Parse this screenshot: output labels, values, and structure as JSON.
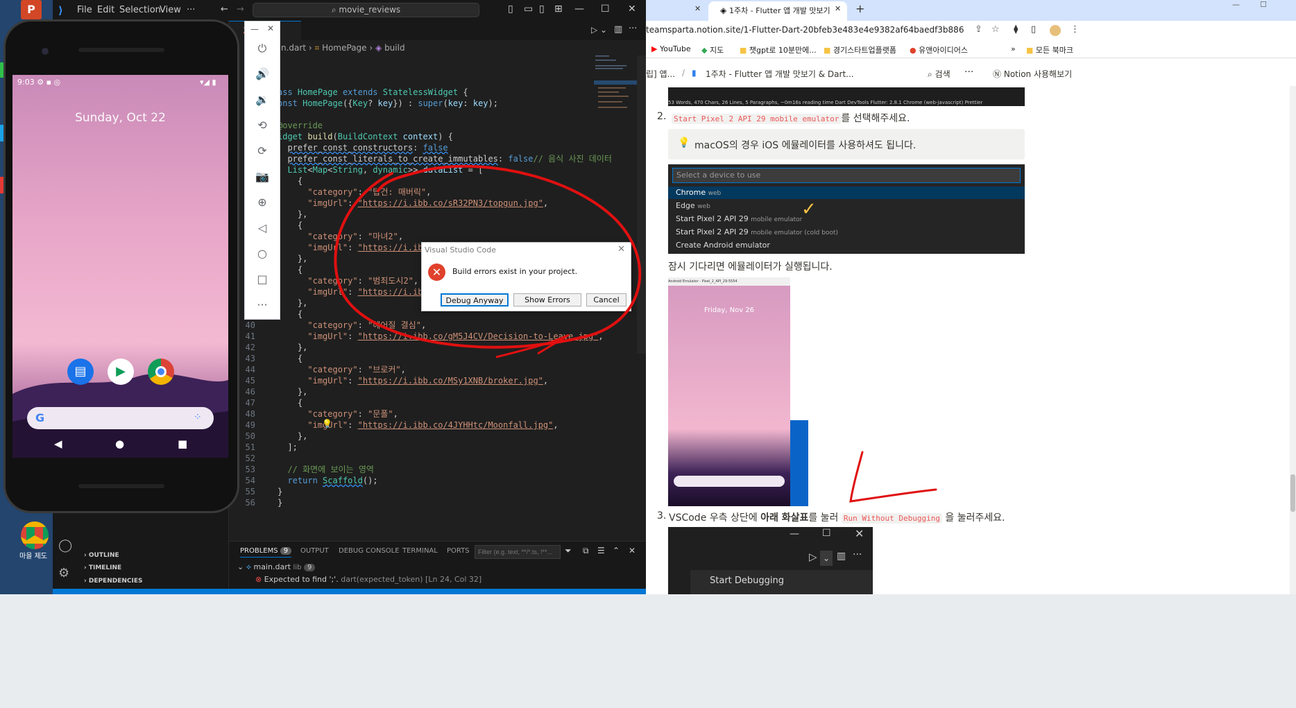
{
  "vscode": {
    "menus": [
      "File",
      "Edit",
      "Selection",
      "View",
      "···"
    ],
    "search": "movie_reviews",
    "tab": {
      "name": "2",
      "close": "×"
    },
    "breadcrumb": [
      "n.dart",
      "HomePage",
      "build"
    ],
    "lines": [
      {
        "n": "",
        "html": "<span class='k'>ass</span> <span class='t'>HomePage</span> <span class='k'>extends</span> <span class='t'>StatelessWidget</span> {"
      },
      {
        "n": "",
        "html": "<span class='k'>onst</span> <span class='t'>HomePage</span>({<span class='t'>Key</span>? <span class='p'>key</span>}) : <span class='k'>super</span>(<span class='p'>key</span>: <span class='p'>key</span>);"
      },
      {
        "n": "",
        "html": ""
      },
      {
        "n": "",
        "html": "<span class='c'>@override</span>"
      },
      {
        "n": "",
        "html": "<span class='t'>idget</span> <span class='f'>build</span>(<span class='t'>BuildContext</span> <span class='p'>context</span>) {"
      },
      {
        "n": "",
        "html": "  <span class='w'>prefer_const_constructors</span>: <span class='k w'>false</span>"
      },
      {
        "n": "",
        "html": "  <span class='w'>prefer_const_literals_to_create_immutables</span>: <span class='k'>false</span><span class='c'>// 음식 사진 데이터</span>"
      },
      {
        "n": "",
        "html": "  <span class='t'>List</span>&lt;<span class='t'>Map</span>&lt;<span class='t'>String</span>, <span class='t'>dynamic</span>&gt;&gt; <span class='p'>dataList</span> = ["
      },
      {
        "n": "",
        "html": "    {"
      },
      {
        "n": "",
        "html": "      <span class='s'>\"category\"</span>: <span class='s'>\"탑건: 매버릭\"</span>,"
      },
      {
        "n": "",
        "html": "      <span class='s'>\"imgUrl\"</span>: <span class='s u'>\"https://i.ibb.co/sR32PN3/topgun.jpg\"</span>,"
      },
      {
        "n": "",
        "html": "    },"
      },
      {
        "n": "",
        "html": "    {"
      },
      {
        "n": "",
        "html": "      <span class='s'>\"category\"</span>: <span class='s'>\"마녀2\"</span>,"
      },
      {
        "n": "",
        "html": "      <span class='s'>\"imgUrl\"</span>: <span class='s u'>\"https://i.ibb.c</span>"
      },
      {
        "n": "",
        "html": "    },"
      },
      {
        "n": "",
        "html": "    {"
      },
      {
        "n": "",
        "html": "      <span class='s'>\"category\"</span>: <span class='s'>\"범죄도시2\"</span>,"
      },
      {
        "n": "",
        "html": "      <span class='s'>\"imgUrl\"</span>: <span class='s u'>\"https://i.ibb.c</span>"
      },
      {
        "n": "",
        "html": "    },"
      },
      {
        "n": "",
        "html": "    {"
      },
      {
        "n": "40",
        "html": "      <span class='s'>\"category\"</span>: <span class='s'>\"헤어질 결심\"</span>,"
      },
      {
        "n": "41",
        "html": "      <span class='s'>\"imgUrl\"</span>: <span class='s u'>\"https://i.ibb.co/gM5J4CV/Decision-to-Leave.jpg\"</span>,"
      },
      {
        "n": "42",
        "html": "    },"
      },
      {
        "n": "43",
        "html": "    {"
      },
      {
        "n": "44",
        "html": "      <span class='s'>\"category\"</span>: <span class='s'>\"브로커\"</span>,"
      },
      {
        "n": "45",
        "html": "      <span class='s'>\"imgUrl\"</span>: <span class='s u'>\"https://i.ibb.co/MSy1XNB/broker.jpg\"</span>,"
      },
      {
        "n": "46",
        "html": "    },"
      },
      {
        "n": "47",
        "html": "    {"
      },
      {
        "n": "48",
        "html": "      <span class='s'>\"category\"</span>: <span class='s'>\"문폴\"</span>,"
      },
      {
        "n": "49",
        "html": "      <span class='s'>\"imgUrl\"</span>: <span class='s u'>\"https://i.ibb.co/4JYHHtc/Moonfall.jpg\"</span>,"
      },
      {
        "n": "50",
        "html": "    },"
      },
      {
        "n": "51",
        "html": "  ];"
      },
      {
        "n": "52",
        "html": ""
      },
      {
        "n": "53",
        "html": "  <span class='c'>// 화면에 보이는 영역</span>"
      },
      {
        "n": "54",
        "html": "  <span class='k'>return</span> <span class='t w'>Scaffold</span>();"
      },
      {
        "n": "55",
        "html": "}"
      },
      {
        "n": "56",
        "html": "}"
      }
    ],
    "sidebar_sections": [
      "OUTLINE",
      "TIMELINE",
      "DEPENDENCIES"
    ],
    "panel": {
      "tabs": [
        "PROBLEMS",
        "OUTPUT",
        "DEBUG CONSOLE",
        "TERMINAL",
        "PORTS"
      ],
      "problems_count": "9",
      "filter_placeholder": "Filter (e.g. text, **/*.ts, !**...",
      "file": "main.dart",
      "file_dir": "lib",
      "file_count": "9",
      "error": "Expected to find ';'.",
      "error_src": "dart(expected_token) [Ln 24, Col 32]"
    },
    "dialog": {
      "title": "Visual Studio Code",
      "message": "Build errors exist in your project.",
      "debug_anyway": "Debug Anyway",
      "show_errors": "Show Errors",
      "cancel": "Cancel"
    }
  },
  "phone": {
    "time": "9:03",
    "date": "Sunday, Oct 22"
  },
  "desktop": {
    "icon_label": "마을 제도"
  },
  "chrome": {
    "tab_title": "1주차 - Flutter 앱 개발 맛보기",
    "url": "teamsparta.notion.site/1-Flutter-Dart-20bfeb3e483e4e9382af64baedf3b886",
    "bookmarks": [
      "YouTube",
      "지도",
      "챗gpt로 10분만에...",
      "경기스타트업플랫폼",
      "유앤아이디어스",
      "모든 북마크"
    ],
    "notion_crumb_prev": "립] 앱...",
    "notion_crumb": "1주차 - Flutter 앱 개발 맛보기 & Dart...",
    "notion_search": "검색",
    "notion_cta": "Notion 사용해보기",
    "vs_status_strip": "53 Words, 470 Chars, 26 Lines, 5 Paragraphs, ~0m16s reading time     Dart DevTools    Flutter: 2.8.1    Chrome (web-javascript)    Prettier",
    "step2_code": "Start Pixel 2 API 29 mobile emulator",
    "step2_text": "를 선택해주세요.",
    "callout": "macOS의 경우 iOS 에뮬레이터를 사용하셔도 됩니다.",
    "device_placeholder": "Select a device to use",
    "devices": [
      {
        "name": "Chrome",
        "sub": "web"
      },
      {
        "name": "Edge",
        "sub": "web"
      },
      {
        "name": "Start Pixel 2 API 29",
        "sub": "mobile emulator"
      },
      {
        "name": "Start Pixel 2 API 29",
        "sub": "mobile emulator (cold boot)"
      },
      {
        "name": "Create Android emulator",
        "sub": ""
      }
    ],
    "wait_text": "잠시 기다리면 에뮬레이터가 실행됩니다.",
    "emu_img_title": "Android Emulator - Pixel_2_API_29:5554",
    "emu_img_date": "Friday, Nov 26",
    "step3_a": "VSCode 우측 상단에",
    "step3_b": "아래 화살표",
    "step3_c": "를 눌러",
    "step3_code": "Run Without Debugging",
    "step3_d": "을 눌러주세요.",
    "start_debugging": "Start Debugging",
    "num2": "2.",
    "num3": "3."
  }
}
